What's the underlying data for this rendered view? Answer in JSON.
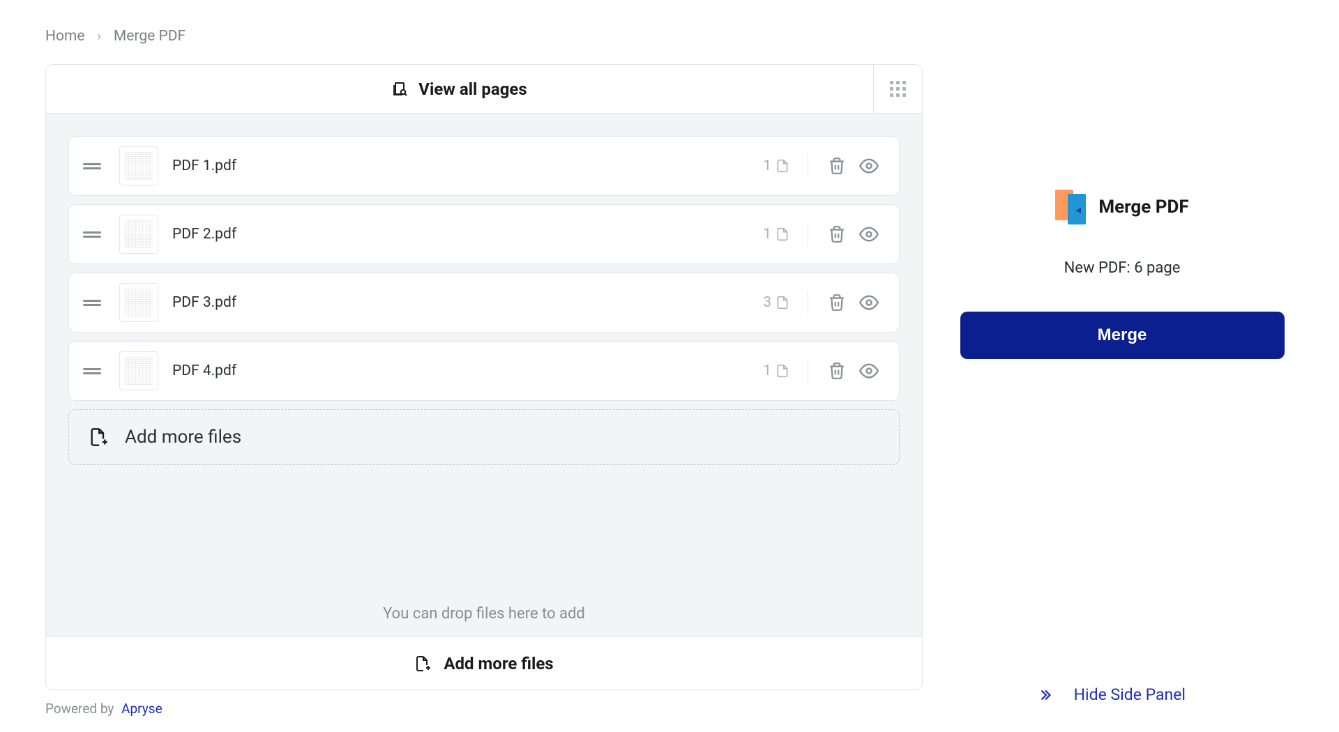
{
  "breadcrumb": {
    "home": "Home",
    "current": "Merge PDF"
  },
  "header": {
    "view_all": "View all pages"
  },
  "files": [
    {
      "name": "PDF 1.pdf",
      "pages": "1"
    },
    {
      "name": "PDF 2.pdf",
      "pages": "1"
    },
    {
      "name": "PDF 3.pdf",
      "pages": "3"
    },
    {
      "name": "PDF 4.pdf",
      "pages": "1"
    }
  ],
  "add_more_dashed": "Add more files",
  "drop_hint": "You can drop files here to add",
  "footer_add_more": "Add more files",
  "side": {
    "title": "Merge PDF",
    "summary": "New PDF: 6 page",
    "merge_button": "Merge",
    "hide_panel": "Hide Side Panel"
  },
  "powered": {
    "prefix": "Powered by",
    "brand": "Apryse"
  }
}
